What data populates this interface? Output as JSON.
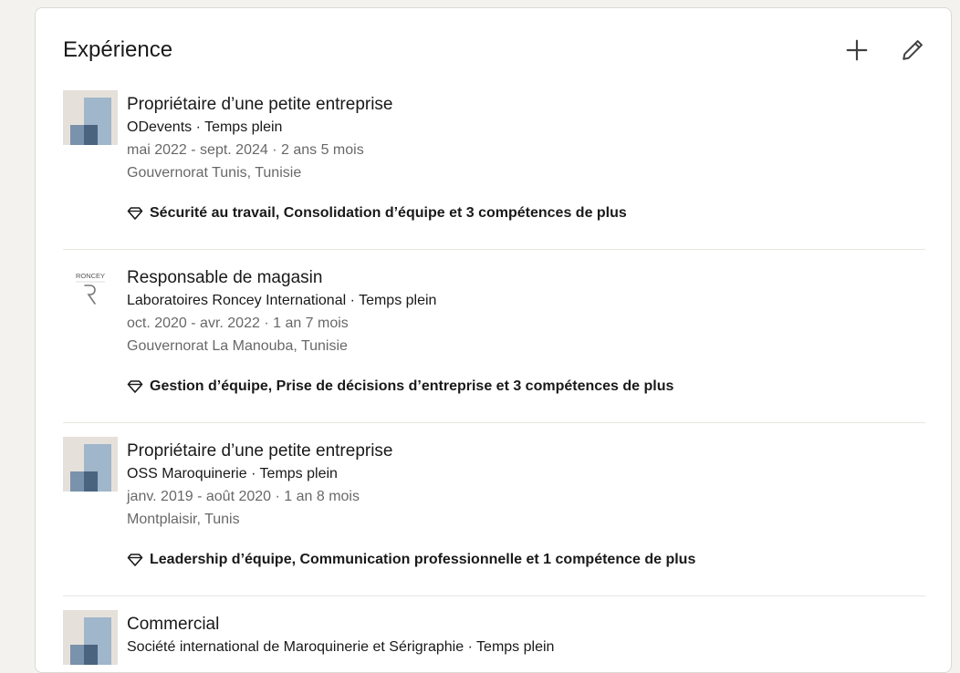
{
  "section": {
    "title": "Expérience",
    "add_icon": "plus-icon",
    "edit_icon": "pencil-icon"
  },
  "colors": {
    "logo_bg": "#e5e1da",
    "logo_light": "#9fb6cb",
    "logo_dark": "#4a6480"
  },
  "experiences": [
    {
      "title": "Propriétaire d’une petite entreprise",
      "company": "ODevents · Temps plein",
      "dates": "mai 2022 - sept. 2024 · 2 ans 5 mois",
      "location": "Gouvernorat Tunis, Tunisie",
      "skills": "Sécurité au travail, Consolidation d’équipe et 3 compétences de plus",
      "logo": "generic-company-logo"
    },
    {
      "title": "Responsable de magasin",
      "company": "Laboratoires Roncey International · Temps plein",
      "dates": "oct. 2020 - avr. 2022 · 1 an 7 mois",
      "location": "Gouvernorat La Manouba, Tunisie",
      "skills": "Gestion d’équipe, Prise de décisions d’entreprise et 3 compétences de plus",
      "logo": "roncey-logo",
      "logo_text": "RONCEY"
    },
    {
      "title": "Propriétaire d’une petite entreprise",
      "company": "OSS Maroquinerie · Temps plein",
      "dates": "janv. 2019 - août 2020 · 1 an 8 mois",
      "location": "Montplaisir, Tunis",
      "skills": "Leadership d’équipe, Communication professionnelle et 1 compétence de plus",
      "logo": "generic-company-logo"
    },
    {
      "title": "Commercial",
      "company": "Société international de Maroquinerie et Sérigraphie · Temps plein",
      "logo": "generic-company-logo"
    }
  ]
}
